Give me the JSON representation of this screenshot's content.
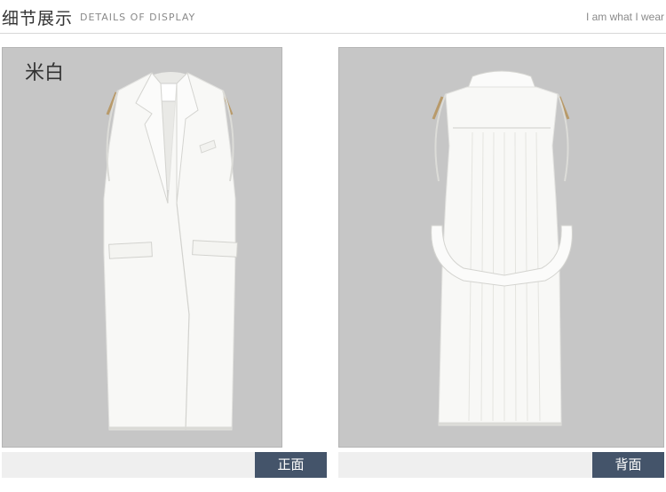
{
  "header": {
    "title_cn": "细节展示",
    "title_en": "DETAILS OF DISPLAY",
    "slogan": "I am what I wear"
  },
  "panels": [
    {
      "color_label": "米白",
      "caption": "正面",
      "garment": "vest-front"
    },
    {
      "caption": "背面",
      "garment": "vest-back"
    }
  ],
  "colors": {
    "panel_bg": "#c6c6c6",
    "caption_bg": "#44546a",
    "caption_bar_bg": "#efefef",
    "garment": "#f7f7f5"
  }
}
